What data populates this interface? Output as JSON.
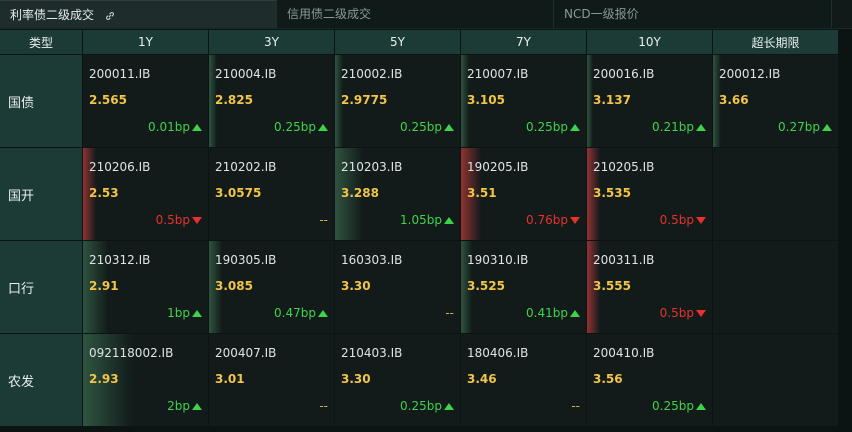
{
  "tabs": [
    {
      "label": "利率债二级成交",
      "active": true
    },
    {
      "label": "信用债二级成交",
      "active": false
    },
    {
      "label": "NCD一级报价",
      "active": false
    }
  ],
  "header": {
    "type_label": "类型",
    "tenors": [
      "1Y",
      "3Y",
      "5Y",
      "7Y",
      "10Y",
      "超长期限"
    ]
  },
  "rows": [
    {
      "label": "国债",
      "cells": [
        {
          "code": "200011.IB",
          "yield": "2.565",
          "change": "0.01bp",
          "dir": "up",
          "bar": 0.0
        },
        {
          "code": "210004.IB",
          "yield": "2.825",
          "change": "0.25bp",
          "dir": "up",
          "bar": 0.06
        },
        {
          "code": "210002.IB",
          "yield": "2.9775",
          "change": "0.25bp",
          "dir": "up",
          "bar": 0.06
        },
        {
          "code": "210007.IB",
          "yield": "3.105",
          "change": "0.25bp",
          "dir": "up",
          "bar": 0.06
        },
        {
          "code": "200016.IB",
          "yield": "3.137",
          "change": "0.21bp",
          "dir": "up",
          "bar": 0.05
        },
        {
          "code": "200012.IB",
          "yield": "3.66",
          "change": "0.27bp",
          "dir": "up",
          "bar": 0.06
        }
      ]
    },
    {
      "label": "国开",
      "cells": [
        {
          "code": "210206.IB",
          "yield": "2.53",
          "change": "0.5bp",
          "dir": "down",
          "bar": 0.1
        },
        {
          "code": "210202.IB",
          "yield": "3.0575",
          "change": "--",
          "dir": "flat",
          "bar": 0.0
        },
        {
          "code": "210203.IB",
          "yield": "3.288",
          "change": "1.05bp",
          "dir": "up",
          "bar": 0.22
        },
        {
          "code": "190205.IB",
          "yield": "3.51",
          "change": "0.76bp",
          "dir": "down",
          "bar": 0.16
        },
        {
          "code": "210205.IB",
          "yield": "3.535",
          "change": "0.5bp",
          "dir": "down",
          "bar": 0.1
        },
        null
      ]
    },
    {
      "label": "口行",
      "cells": [
        {
          "code": "210312.IB",
          "yield": "2.91",
          "change": "1bp",
          "dir": "up",
          "bar": 0.2
        },
        {
          "code": "190305.IB",
          "yield": "3.085",
          "change": "0.47bp",
          "dir": "up",
          "bar": 0.1
        },
        {
          "code": "160303.IB",
          "yield": "3.30",
          "change": "--",
          "dir": "flat",
          "bar": 0.0
        },
        {
          "code": "190310.IB",
          "yield": "3.525",
          "change": "0.41bp",
          "dir": "up",
          "bar": 0.09
        },
        {
          "code": "200311.IB",
          "yield": "3.555",
          "change": "0.5bp",
          "dir": "down",
          "bar": 0.1
        },
        null
      ]
    },
    {
      "label": "农发",
      "cells": [
        {
          "code": "092118002.IB",
          "yield": "2.93",
          "change": "2bp",
          "dir": "up",
          "bar": 0.4
        },
        {
          "code": "200407.IB",
          "yield": "3.01",
          "change": "--",
          "dir": "flat",
          "bar": 0.0
        },
        {
          "code": "210403.IB",
          "yield": "3.30",
          "change": "0.25bp",
          "dir": "up",
          "bar": 0.0
        },
        {
          "code": "180406.IB",
          "yield": "3.46",
          "change": "--",
          "dir": "flat",
          "bar": 0.0
        },
        {
          "code": "200410.IB",
          "yield": "3.56",
          "change": "0.25bp",
          "dir": "up",
          "bar": 0.0
        },
        null
      ]
    }
  ],
  "colors": {
    "up": "#3fd34a",
    "down": "#e8312d",
    "yield": "#f2c447",
    "header_bg": "#1c3a36"
  }
}
